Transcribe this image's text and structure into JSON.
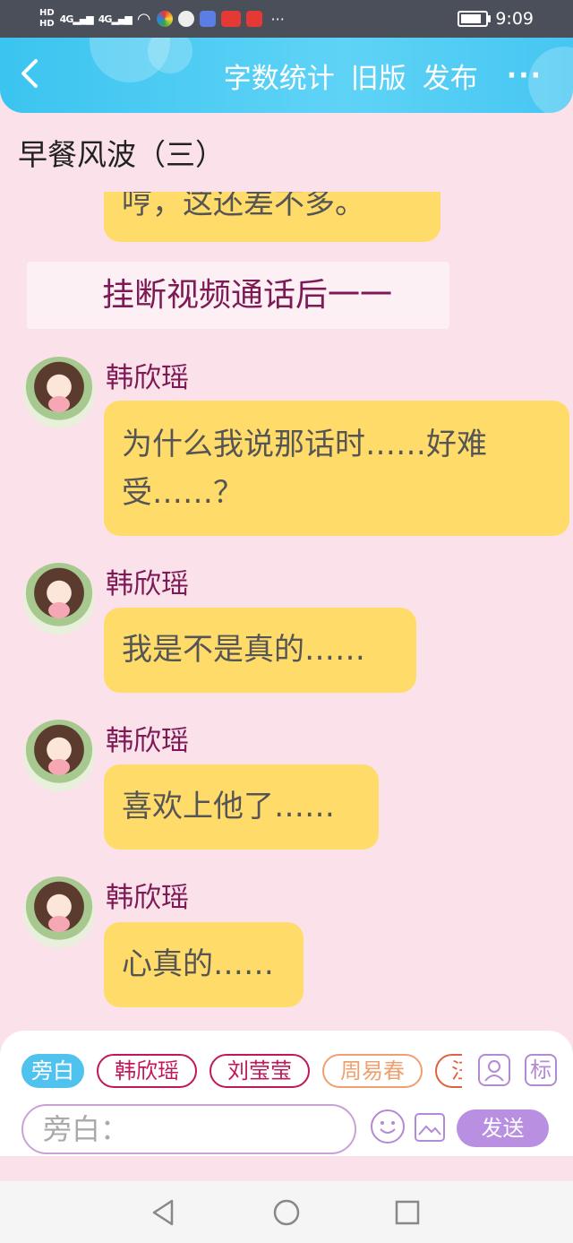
{
  "status_bar": {
    "hd1": "HD",
    "hd2": "HD",
    "signal1": "4G",
    "signal2": "4G",
    "time": "9:09"
  },
  "header": {
    "actions": [
      "字数统计",
      "旧版",
      "发布"
    ],
    "more": "···"
  },
  "story": {
    "title": "早餐风波（三）"
  },
  "chat": {
    "top_partial": "哼，这还差不多。",
    "narration": "挂断视频通话后一一",
    "messages": [
      {
        "sender": "韩欣瑶",
        "text_line1": "为什么我说那话时……好难",
        "text_line2": "受……？"
      },
      {
        "sender": "韩欣瑶",
        "text": "我是不是真的……"
      },
      {
        "sender": "韩欣瑶",
        "text": "喜欢上他了……"
      },
      {
        "sender": "韩欣瑶",
        "text": "心真的……"
      }
    ]
  },
  "composer": {
    "chips": [
      "旁白",
      "韩欣瑶",
      "刘莹莹",
      "周易春",
      "汪"
    ],
    "chip_colors": [
      "#4fc3ee",
      "#c2185b",
      "#c2185b",
      "#f0a070",
      "#e06040"
    ],
    "mark_label": "标",
    "input_placeholder": "旁白：",
    "send_label": "发送"
  },
  "colors": {
    "accent": "#4fc3ee",
    "bubble": "#ffdb6a",
    "sender_name": "#7d1a55",
    "background": "#fbe2ea"
  }
}
